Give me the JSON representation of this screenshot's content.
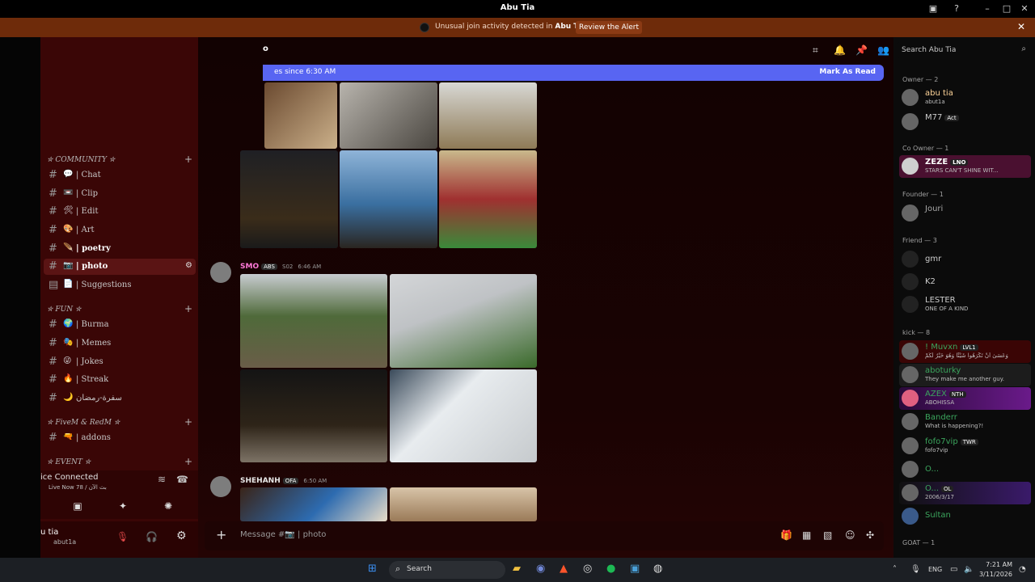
{
  "window": {
    "title": "Abu Tia"
  },
  "alert": {
    "text_prefix": "Unusual join activity detected in",
    "server_name": "Abu Tia",
    "button": "Review the Alert"
  },
  "header": {
    "channel_fragment": "o"
  },
  "new_messages": {
    "text": "es since 6:30 AM",
    "action": "Mark As Read"
  },
  "sidebar": {
    "categories": [
      {
        "label": "✮ COMMUNITY ✮",
        "channels": [
          {
            "emoji": "💬",
            "label": "| Chat"
          },
          {
            "emoji": "📼",
            "label": "| Clip"
          },
          {
            "emoji": "🛠",
            "label": "| Edit"
          },
          {
            "emoji": "🎨",
            "label": "| Art"
          },
          {
            "emoji": "🪶",
            "label": "| poetry"
          },
          {
            "emoji": "📷",
            "label": "| photo"
          },
          {
            "emoji": "📄",
            "label": "| Suggestions"
          }
        ]
      },
      {
        "label": "✮ FUN ✮",
        "channels": [
          {
            "emoji": "🌍",
            "label": "| Burma"
          },
          {
            "emoji": "🎭",
            "label": "| Memes"
          },
          {
            "emoji": "😜",
            "label": "| Jokes"
          },
          {
            "emoji": "🔥",
            "label": "| Streak"
          },
          {
            "emoji": "🌙",
            "label": "سفرة-رمضان"
          }
        ]
      },
      {
        "label": "✮ FiveM & RedM ✮",
        "channels": [
          {
            "emoji": "🔫",
            "label": "| addons"
          }
        ]
      },
      {
        "label": "✮ EVENT ✮",
        "channels": []
      }
    ]
  },
  "voice": {
    "title": "ice Connected",
    "subtitle": "Live Now 78 / بث الآن"
  },
  "user": {
    "name": "u tia",
    "handle": "abut1a"
  },
  "messages": [
    {
      "author": "SMO",
      "tag": "ABS",
      "extra": "S02",
      "time": "6:46 AM"
    },
    {
      "author": "SHEHANH",
      "tag": "OFA",
      "time": "6:50 AM"
    }
  ],
  "composer": {
    "placeholder": "Message #📷 | photo"
  },
  "members": {
    "search": "Search Abu Tia",
    "groups": [
      {
        "role": "Owner — 2",
        "items": [
          {
            "name": "abu tia",
            "status": "abut1a",
            "badge": ""
          },
          {
            "name": "M77",
            "status": "",
            "badge": "Act"
          }
        ]
      },
      {
        "role": "Co Owner — 1",
        "items": [
          {
            "name": "ZEZE",
            "status": "STARS CAN'T SHINE WIT...",
            "badge": "LNO"
          }
        ]
      },
      {
        "role": "Founder — 1",
        "items": [
          {
            "name": "Jouri",
            "status": "",
            "badge": ""
          }
        ]
      },
      {
        "role": "Friend — 3",
        "items": [
          {
            "name": "gmr",
            "status": "",
            "badge": ""
          },
          {
            "name": "K2",
            "status": "",
            "badge": ""
          },
          {
            "name": "LESTER",
            "status": "ONE OF A KIND",
            "badge": ""
          }
        ]
      },
      {
        "role": "kick — 8",
        "items": [
          {
            "name": "! Muvxn",
            "status": "وَعَسَىٰ أَنْ تَكْرَهُوا شَيْئًا وَهُوَ خَيْرٌ لَكُمْ",
            "badge": "LVL1"
          },
          {
            "name": "aboturky",
            "status": "They make me another guy.",
            "badge": ""
          },
          {
            "name": "AZEX",
            "status": "ABOHISSA",
            "badge": "NTH"
          },
          {
            "name": "Banderr",
            "status": "What is happening?!",
            "badge": ""
          },
          {
            "name": "fofo7vip",
            "status": "fofo7vip",
            "badge": "TWR"
          },
          {
            "name": "O...",
            "status": "",
            "badge": ""
          },
          {
            "name": "O...",
            "status": "2006/3/17",
            "badge": "OL"
          },
          {
            "name": "Sultan",
            "status": "",
            "badge": ""
          }
        ]
      },
      {
        "role": "GOAT — 1",
        "items": []
      }
    ]
  },
  "taskbar": {
    "search": "Search",
    "lang": "ENG",
    "time": "7:21 AM",
    "date": "3/11/2026"
  },
  "colors": {
    "accent": "#5865f2",
    "alert_bg": "#6e2b0a",
    "sidebar_bg": "#3a0606",
    "name_green": "#3ba55d",
    "name_pink": "#ff7ad9"
  }
}
